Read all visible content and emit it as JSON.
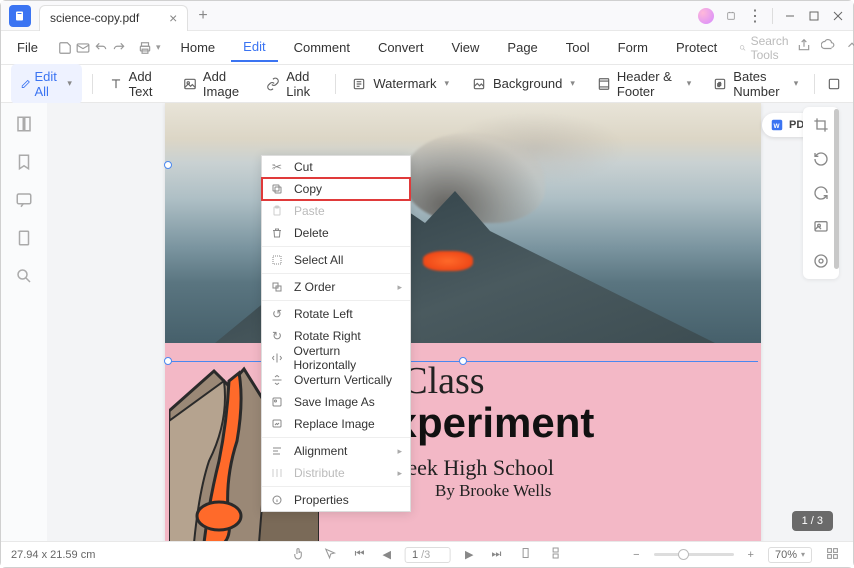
{
  "tab": {
    "title": "science-copy.pdf"
  },
  "menu": {
    "file": "File",
    "items": [
      "Home",
      "Edit",
      "Comment",
      "Convert",
      "View",
      "Page",
      "Tool",
      "Form",
      "Protect"
    ],
    "active_index": 1,
    "search_placeholder": "Search Tools"
  },
  "toolbar": {
    "edit_all": "Edit All",
    "add_text": "Add Text",
    "add_image": "Add Image",
    "add_link": "Add Link",
    "watermark": "Watermark",
    "background": "Background",
    "header_footer": "Header & Footer",
    "bates_number": "Bates Number"
  },
  "document": {
    "title_line1": "nce Class",
    "title_line2": ": Experiment",
    "subtitle1": "reek High School",
    "subtitle2": "By Brooke Wells"
  },
  "pdf_badge": "PDF",
  "context_menu": {
    "cut": "Cut",
    "copy": "Copy",
    "paste": "Paste",
    "delete": "Delete",
    "select_all": "Select All",
    "z_order": "Z Order",
    "rotate_left": "Rotate Left",
    "rotate_right": "Rotate Right",
    "overturn_h": "Overturn Horizontally",
    "overturn_v": "Overturn Vertically",
    "save_image": "Save Image As",
    "replace_image": "Replace Image",
    "alignment": "Alignment",
    "distribute": "Distribute",
    "properties": "Properties"
  },
  "page_indicator": "1 / 3",
  "status": {
    "dimensions": "27.94 x 21.59 cm",
    "page_current": "1",
    "page_total": "/3",
    "zoom": "70%"
  }
}
